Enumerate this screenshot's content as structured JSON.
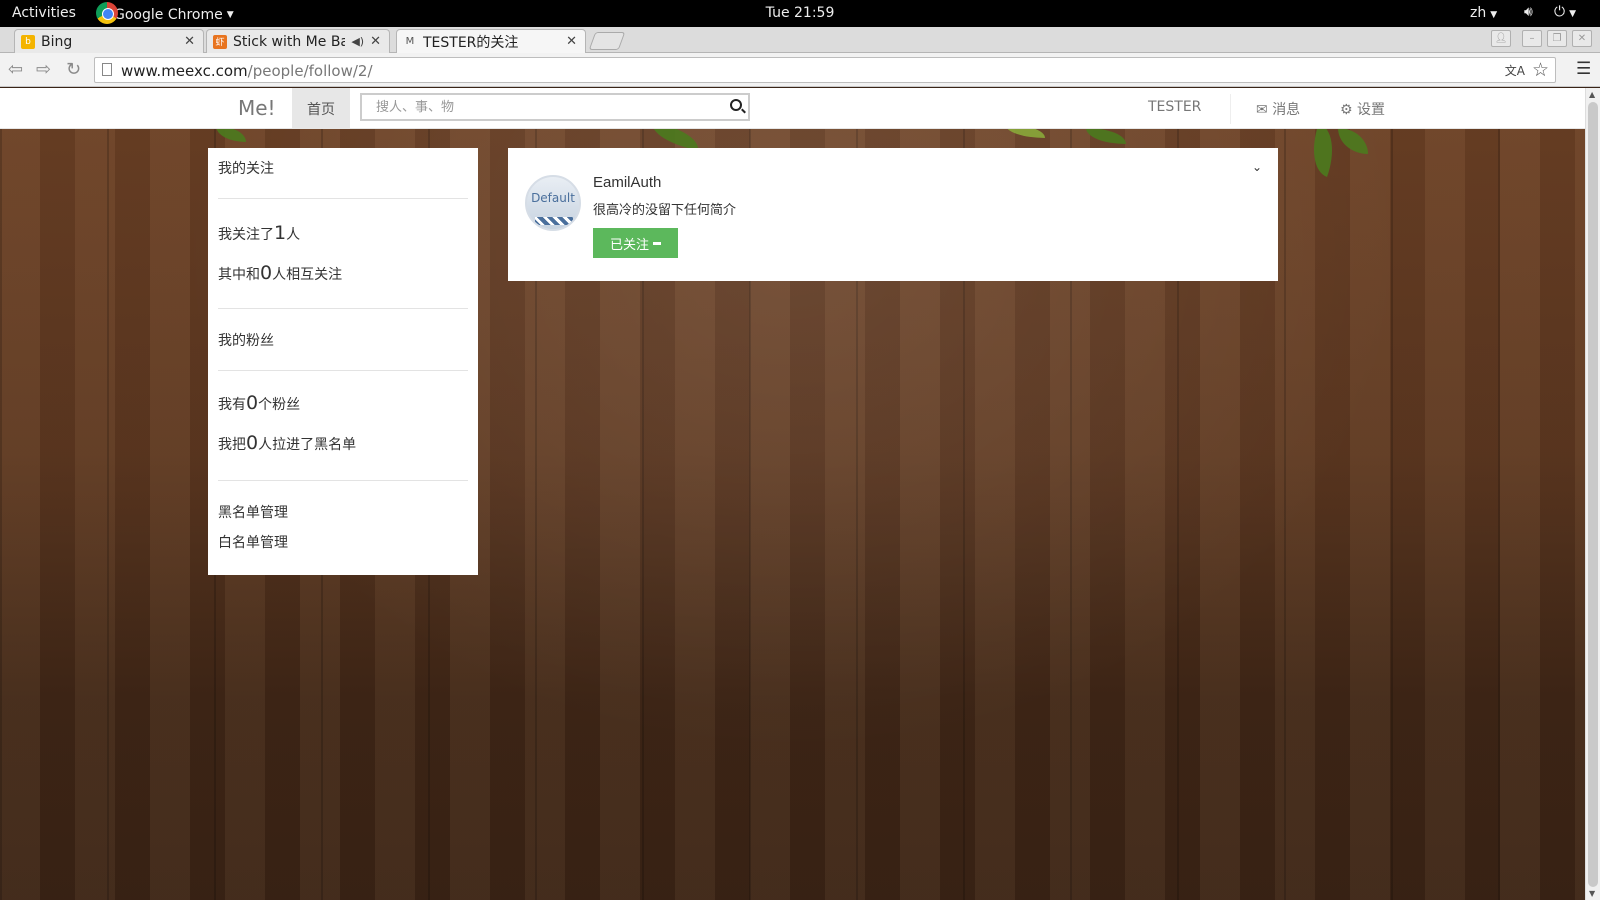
{
  "os_bar": {
    "activities": "Activities",
    "app_name": "Google Chrome",
    "clock": "Tue 21:59",
    "language": "zh"
  },
  "browser": {
    "tabs": [
      {
        "title": "Bing",
        "favicon": "bing-icon",
        "active": false
      },
      {
        "title": "Stick with Me Bab",
        "favicon": "music-site-icon",
        "active": false,
        "audio": true
      },
      {
        "title": "TESTER的关注",
        "favicon": "meexc-icon",
        "active": true
      }
    ],
    "url_host": "www.meexc.com",
    "url_path": "/people/follow/2/"
  },
  "site": {
    "brand": "Me!",
    "home_label": "首页",
    "search_placeholder": "搜人、事、物",
    "username": "TESTER",
    "messages_label": "消息",
    "settings_label": "设置"
  },
  "sidebar": {
    "my_follows_title": "我的关注",
    "following_prefix": "我关注了",
    "following_count": "1",
    "following_suffix": "人",
    "mutual_prefix": "其中和",
    "mutual_count": "0",
    "mutual_suffix": "人相互关注",
    "fans_title": "我的粉丝",
    "fans_prefix": "我有",
    "fans_count": "0",
    "fans_suffix": "个粉丝",
    "blocked_prefix": "我把",
    "blocked_count": "0",
    "blocked_suffix": "人拉进了黑名单",
    "blacklist_link": "黑名单管理",
    "whitelist_link": "白名单管理"
  },
  "follow_card": {
    "avatar_text": "Default",
    "name": "EamilAuth",
    "bio": "很高冷的没留下任何简介",
    "button_label": "已关注"
  },
  "colors": {
    "follow_button": "#5cb85c",
    "navbar": "#ffffff",
    "wood": "#5c3720"
  }
}
